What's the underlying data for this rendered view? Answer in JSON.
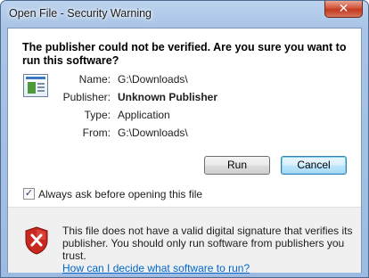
{
  "window": {
    "title": "Open File - Security Warning",
    "close_label": "✕"
  },
  "dialog": {
    "headline": "The publisher could not be verified.  Are you sure you want to run this software?",
    "fields": [
      {
        "label": "Name:",
        "value": "G:\\Downloads\\"
      },
      {
        "label": "Publisher:",
        "value": "Unknown Publisher"
      },
      {
        "label": "Type:",
        "value": "Application"
      },
      {
        "label": "From:",
        "value": "G:\\Downloads\\"
      }
    ],
    "run_label": "Run",
    "cancel_label": "Cancel",
    "checkbox_label": "Always ask before opening this file",
    "checkbox_checked": true,
    "checkbox_mark": "✓"
  },
  "warning": {
    "text": "This file does not have a valid digital signature that verifies its publisher.  You should only run software from publishers you trust.",
    "link": "How can I decide what software to run?",
    "icon": "shield-error-icon"
  },
  "colors": {
    "link": "#0066cc",
    "shield_red": "#c8281e"
  }
}
